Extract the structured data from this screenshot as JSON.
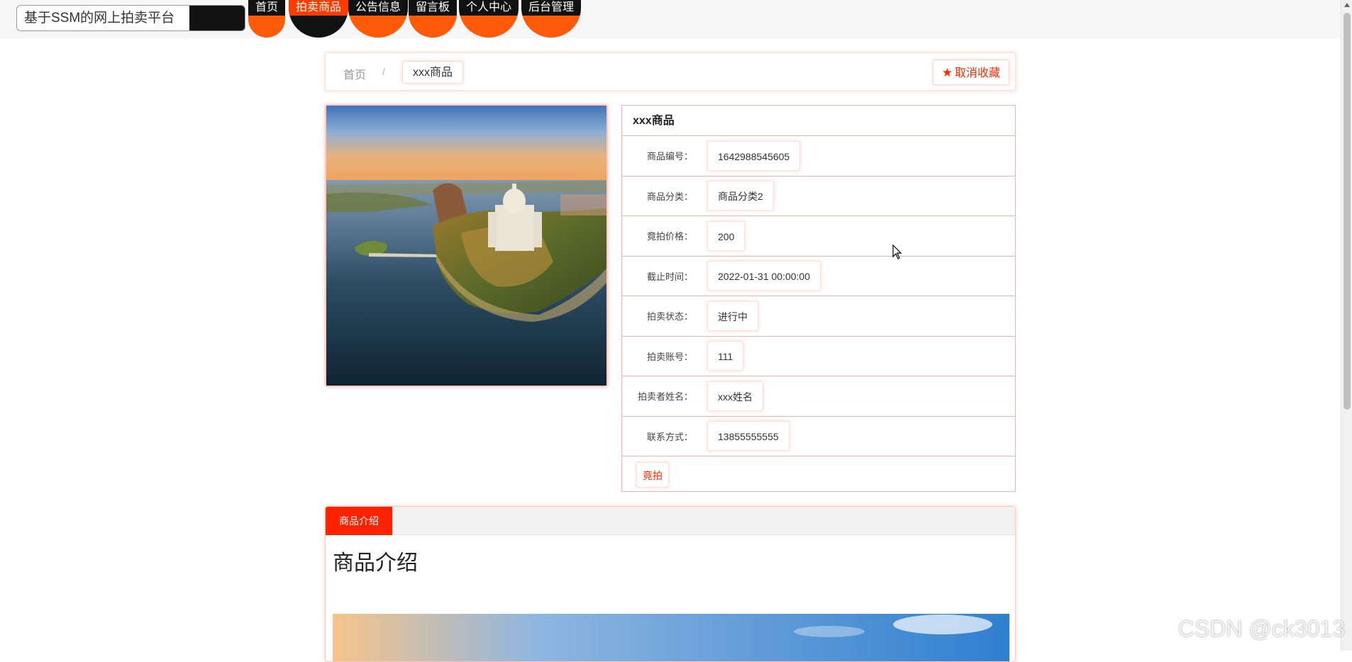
{
  "site": {
    "title": "基于SSM的网上拍卖平台"
  },
  "nav": {
    "items": [
      {
        "label": "首页"
      },
      {
        "label": "拍卖商品"
      },
      {
        "label": "公告信息"
      },
      {
        "label": "留言板"
      },
      {
        "label": "个人中心"
      },
      {
        "label": "后台管理"
      }
    ],
    "active_index": 1
  },
  "breadcrumb": {
    "home": "首页",
    "separator": "/",
    "current": "xxx商品"
  },
  "favorite": {
    "label": "取消收藏",
    "icon": "star-icon"
  },
  "product": {
    "name": "xxx商品",
    "fields": [
      {
        "label": "商品编号：",
        "value": "1642988545605"
      },
      {
        "label": "商品分类：",
        "value": "商品分类2"
      },
      {
        "label": "竟拍价格：",
        "value": "200"
      },
      {
        "label": "截止时间：",
        "value": "2022-01-31 00:00:00"
      },
      {
        "label": "拍卖状态：",
        "value": "进行中"
      },
      {
        "label": "拍卖账号：",
        "value": "111"
      },
      {
        "label": "拍卖者姓名：",
        "value": "xxx姓名"
      },
      {
        "label": "联系方式：",
        "value": "13855555555"
      }
    ],
    "bid_label": "竟拍"
  },
  "intro": {
    "tab_label": "商品介绍",
    "heading": "商品介绍"
  },
  "watermark": "CSDN @ck3013",
  "colors": {
    "accent": "#ff2200",
    "nav_orange": "#ff5a0a",
    "nav_black": "#111111",
    "border_pink": "#f2b3ab"
  }
}
